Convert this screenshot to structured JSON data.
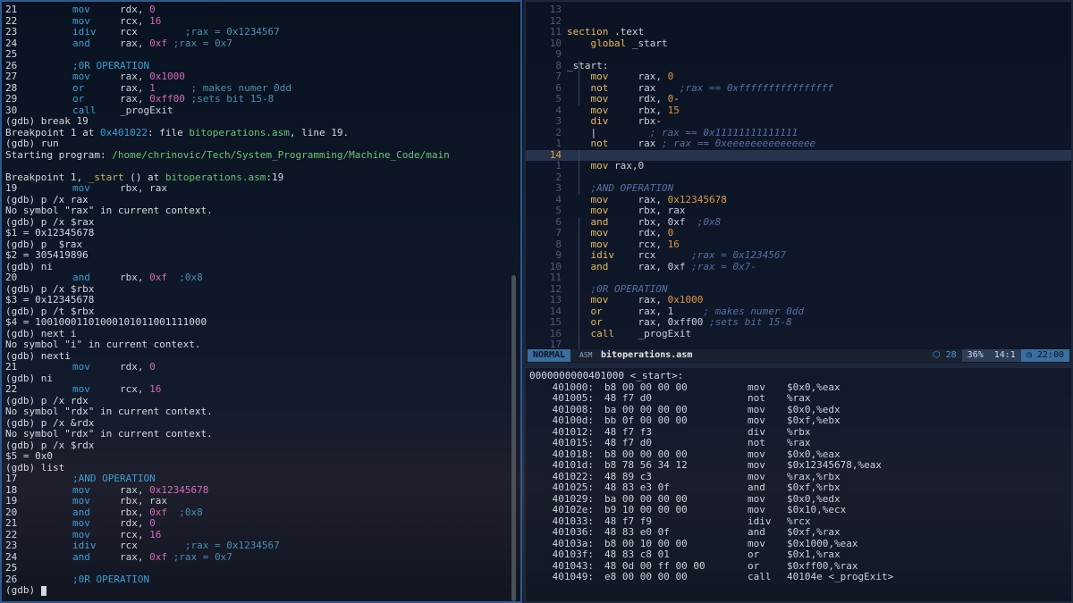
{
  "gdb": {
    "lines": [
      {
        "t": "src",
        "n": "21",
        "ins": "mov",
        "a": "rdx",
        "b": "0",
        "c": ""
      },
      {
        "t": "src",
        "n": "22",
        "ins": "mov",
        "a": "rcx",
        "b": "16",
        "c": ""
      },
      {
        "t": "src",
        "n": "23",
        "ins": "idiv",
        "a": "rcx",
        "b": "",
        "c": "        ;rax = 0x1234567"
      },
      {
        "t": "src",
        "n": "24",
        "ins": "and",
        "a": "rax",
        "b": "0xf",
        "c": " ;rax = 0x7"
      },
      {
        "t": "plain",
        "s": "25"
      },
      {
        "t": "srccmt",
        "n": "26",
        "c": ";0R OPERATION"
      },
      {
        "t": "src",
        "n": "27",
        "ins": "mov",
        "a": "rax",
        "b": "0x1000",
        "c": ""
      },
      {
        "t": "src",
        "n": "28",
        "ins": "or",
        "a": "rax",
        "b": "1",
        "c": "      ; makes numer 0dd"
      },
      {
        "t": "src",
        "n": "29",
        "ins": "or",
        "a": "rax",
        "b": "0xff00",
        "c": " ;sets bit 15-8"
      },
      {
        "t": "src1",
        "n": "30",
        "ins": "call",
        "a": "_progExit"
      },
      {
        "t": "plain",
        "s": "(gdb) break 19"
      },
      {
        "t": "bp",
        "pre": "Breakpoint 1 at ",
        "addr": "0x401022",
        "mid": ": file ",
        "file": "bitoperations.asm",
        "post": ", line 19."
      },
      {
        "t": "plain",
        "s": "(gdb) run"
      },
      {
        "t": "start",
        "pre": "Starting program: ",
        "path": "/home/chrinovic/Tech/System_Programming/Machine_Code/main"
      },
      {
        "t": "plain",
        "s": ""
      },
      {
        "t": "hit",
        "pre": "Breakpoint 1, ",
        "fn": "_start",
        "mid": " () at ",
        "file": "bitoperations.asm",
        "post": ":19"
      },
      {
        "t": "src",
        "n": "19",
        "ins": "mov",
        "a": "rbx",
        "b": "rax",
        "c": "",
        "breg": true
      },
      {
        "t": "plain",
        "s": "(gdb) p /x rax"
      },
      {
        "t": "plain",
        "s": "No symbol \"rax\" in current context."
      },
      {
        "t": "plain",
        "s": "(gdb) p /x $rax"
      },
      {
        "t": "plain",
        "s": "$1 = 0x12345678"
      },
      {
        "t": "plain",
        "s": "(gdb) p  $rax"
      },
      {
        "t": "plain",
        "s": "$2 = 305419896"
      },
      {
        "t": "plain",
        "s": "(gdb) ni"
      },
      {
        "t": "src",
        "n": "20",
        "ins": "and",
        "a": "rbx",
        "b": "0xf",
        "c": "  ;0x8"
      },
      {
        "t": "plain",
        "s": "(gdb) p /x $rbx"
      },
      {
        "t": "plain",
        "s": "$3 = 0x12345678"
      },
      {
        "t": "plain",
        "s": "(gdb) p /t $rbx"
      },
      {
        "t": "plain",
        "s": "$4 = 10010001101000101011001111000"
      },
      {
        "t": "plain",
        "s": "(gdb) next i"
      },
      {
        "t": "plain",
        "s": "No symbol \"i\" in current context."
      },
      {
        "t": "plain",
        "s": "(gdb) nexti"
      },
      {
        "t": "src",
        "n": "21",
        "ins": "mov",
        "a": "rdx",
        "b": "0",
        "c": ""
      },
      {
        "t": "plain",
        "s": "(gdb) ni"
      },
      {
        "t": "src",
        "n": "22",
        "ins": "mov",
        "a": "rcx",
        "b": "16",
        "c": ""
      },
      {
        "t": "plain",
        "s": "(gdb) p /x rdx"
      },
      {
        "t": "plain",
        "s": "No symbol \"rdx\" in current context."
      },
      {
        "t": "plain",
        "s": "(gdb) p /x &rdx"
      },
      {
        "t": "plain",
        "s": "No symbol \"rdx\" in current context."
      },
      {
        "t": "plain",
        "s": "(gdb) p /x $rdx"
      },
      {
        "t": "plain",
        "s": "$5 = 0x0"
      },
      {
        "t": "plain",
        "s": "(gdb) list"
      },
      {
        "t": "srccmt",
        "n": "17",
        "c": ";AND OPERATION"
      },
      {
        "t": "src",
        "n": "18",
        "ins": "mov",
        "a": "rax",
        "b": "0x12345678",
        "c": ""
      },
      {
        "t": "src",
        "n": "19",
        "ins": "mov",
        "a": "rbx",
        "b": "rax",
        "c": "",
        "breg": true
      },
      {
        "t": "src",
        "n": "20",
        "ins": "and",
        "a": "rbx",
        "b": "0xf",
        "c": "  ;0x8"
      },
      {
        "t": "src",
        "n": "21",
        "ins": "mov",
        "a": "rdx",
        "b": "0",
        "c": ""
      },
      {
        "t": "src",
        "n": "22",
        "ins": "mov",
        "a": "rcx",
        "b": "16",
        "c": ""
      },
      {
        "t": "src",
        "n": "23",
        "ins": "idiv",
        "a": "rcx",
        "b": "",
        "c": "        ;rax = 0x1234567"
      },
      {
        "t": "src",
        "n": "24",
        "ins": "and",
        "a": "rax",
        "b": "0xf",
        "c": " ;rax = 0x7"
      },
      {
        "t": "plain",
        "s": "25"
      },
      {
        "t": "srccmt",
        "n": "26",
        "c": ";0R OPERATION"
      },
      {
        "t": "prompt",
        "s": "(gdb) "
      }
    ]
  },
  "editor": {
    "lines": [
      {
        "ln": "13",
        "html": ""
      },
      {
        "ln": "12",
        "html": ""
      },
      {
        "ln": "11",
        "code": "section .text",
        "k": "plain"
      },
      {
        "ln": "10",
        "code": "    global _start",
        "k": "plain"
      },
      {
        "ln": "9",
        "code": "",
        "k": "plain"
      },
      {
        "ln": "8",
        "code": "_start:",
        "k": "plain"
      },
      {
        "ln": "7",
        "code": "    mov     rax, 0",
        "k": "num"
      },
      {
        "ln": "6",
        "code": "    not     rax",
        "cmt": "    ;rax == 0xffffffffffffffff"
      },
      {
        "ln": "5",
        "code": "    mov     rdx, 0-",
        "k": "num"
      },
      {
        "ln": "4",
        "code": "    mov     rbx, 15",
        "k": "num"
      },
      {
        "ln": "3",
        "code": "    div     rbx-",
        "k": "plain"
      },
      {
        "ln": "2",
        "code": "    |",
        "cmt": "         ; rax == 0x11111111111111"
      },
      {
        "ln": "1",
        "code": "    not     rax",
        "cmt": " ; rax == 0xeeeeeeeeeeeeeee"
      },
      {
        "ln": "14",
        "code": "",
        "cur": true
      },
      {
        "ln": "1",
        "code": "    mov rax,0",
        "k": "plain"
      },
      {
        "ln": "2",
        "code": "",
        "k": "plain"
      },
      {
        "ln": "3",
        "cmt": "    ;AND OPERATION"
      },
      {
        "ln": "4",
        "code": "    mov     rax, 0x12345678",
        "k": "num"
      },
      {
        "ln": "5",
        "code": "    mov     rbx, rax",
        "k": "plain"
      },
      {
        "ln": "6",
        "code": "    and     rbx, 0xf",
        "cmt": "  ;0x8"
      },
      {
        "ln": "7",
        "code": "    mov     rdx, 0",
        "k": "num"
      },
      {
        "ln": "8",
        "code": "    mov     rcx, 16",
        "k": "num"
      },
      {
        "ln": "9",
        "code": "    idiv    rcx",
        "cmt": "      ;rax = 0x1234567"
      },
      {
        "ln": "10",
        "code": "    and     rax, 0xf",
        "cmt": " ;rax = 0x7-"
      },
      {
        "ln": "11",
        "code": "",
        "k": "plain"
      },
      {
        "ln": "12",
        "cmt": "    ;0R OPERATION"
      },
      {
        "ln": "13",
        "code": "    mov     rax, 0x1000",
        "k": "num"
      },
      {
        "ln": "14",
        "code": "    or      rax, 1",
        "cmt": "     ; makes numer 0dd"
      },
      {
        "ln": "15",
        "code": "    or      rax, 0xff00",
        "cmt": " ;sets bit 15-8"
      },
      {
        "ln": "16",
        "code": "    call    _progExit",
        "k": "plain"
      },
      {
        "ln": "17",
        "code": "",
        "k": "plain"
      }
    ],
    "status": {
      "mode": "NORMAL",
      "filetype_icon": "ASM",
      "filename": "bitoperations.asm",
      "line_count": "28",
      "percent": "36%",
      "position": "14:1",
      "time": "22:00"
    }
  },
  "objdump": {
    "header": "0000000000401000 <_start>:",
    "rows": [
      {
        "addr": "401000:",
        "bytes": "b8 00 00 00 00",
        "mn": "mov",
        "op": "$0x0,%eax"
      },
      {
        "addr": "401005:",
        "bytes": "48 f7 d0",
        "mn": "not",
        "op": "%rax"
      },
      {
        "addr": "401008:",
        "bytes": "ba 00 00 00 00",
        "mn": "mov",
        "op": "$0x0,%edx"
      },
      {
        "addr": "40100d:",
        "bytes": "bb 0f 00 00 00",
        "mn": "mov",
        "op": "$0xf,%ebx"
      },
      {
        "addr": "401012:",
        "bytes": "48 f7 f3",
        "mn": "div",
        "op": "%rbx"
      },
      {
        "addr": "401015:",
        "bytes": "48 f7 d0",
        "mn": "not",
        "op": "%rax"
      },
      {
        "addr": "401018:",
        "bytes": "b8 00 00 00 00",
        "mn": "mov",
        "op": "$0x0,%eax"
      },
      {
        "addr": "40101d:",
        "bytes": "b8 78 56 34 12",
        "mn": "mov",
        "op": "$0x12345678,%eax"
      },
      {
        "addr": "401022:",
        "bytes": "48 89 c3",
        "mn": "mov",
        "op": "%rax,%rbx"
      },
      {
        "addr": "401025:",
        "bytes": "48 83 e3 0f",
        "mn": "and",
        "op": "$0xf,%rbx"
      },
      {
        "addr": "401029:",
        "bytes": "ba 00 00 00 00",
        "mn": "mov",
        "op": "$0x0,%edx"
      },
      {
        "addr": "40102e:",
        "bytes": "b9 10 00 00 00",
        "mn": "mov",
        "op": "$0x10,%ecx"
      },
      {
        "addr": "401033:",
        "bytes": "48 f7 f9",
        "mn": "idiv",
        "op": "%rcx"
      },
      {
        "addr": "401036:",
        "bytes": "48 83 e0 0f",
        "mn": "and",
        "op": "$0xf,%rax"
      },
      {
        "addr": "40103a:",
        "bytes": "b8 00 10 00 00",
        "mn": "mov",
        "op": "$0x1000,%eax"
      },
      {
        "addr": "40103f:",
        "bytes": "48 83 c8 01",
        "mn": "or",
        "op": "$0x1,%rax"
      },
      {
        "addr": "401043:",
        "bytes": "48 0d 00 ff 00 00",
        "mn": "or",
        "op": "$0xff00,%rax"
      },
      {
        "addr": "401049:",
        "bytes": "e8 00 00 00 00",
        "mn": "call",
        "op": "40104e <_progExit>"
      }
    ]
  },
  "colors": {
    "active_border": "#2e5a8e",
    "gdb_keyword": "#3a9fd5",
    "gdb_immediate": "#d46ab8",
    "gdb_comment": "#4a8fb0",
    "gdb_path": "#6ec27a",
    "editor_number": "#e0953a",
    "editor_comment": "#5270a0",
    "cursor_line_number": "#e0a030",
    "status_accent": "#3a6f9e"
  }
}
